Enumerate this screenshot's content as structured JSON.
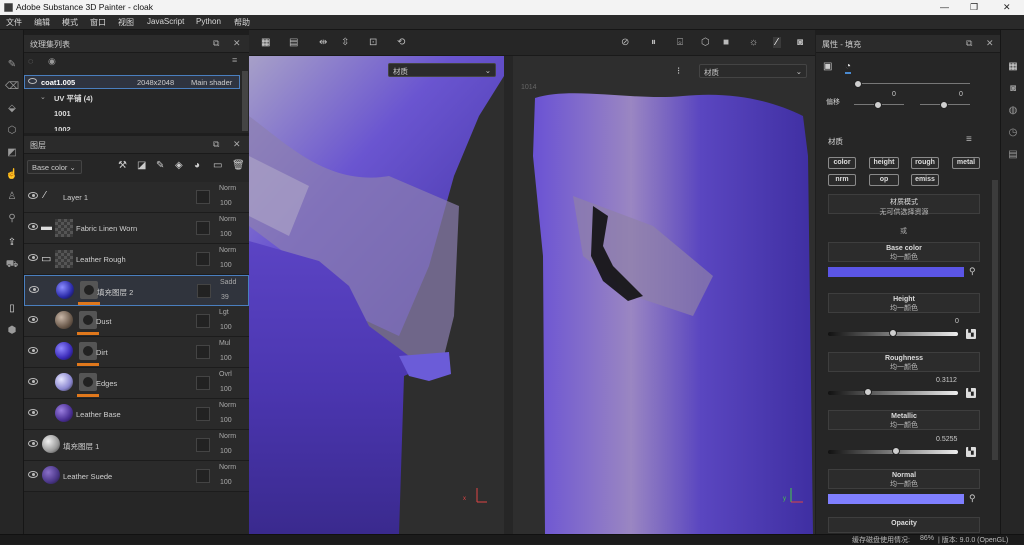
{
  "window": {
    "title": "Adobe Substance 3D Painter - cloak",
    "minimize": "—",
    "maximize": "❐",
    "close": "✕"
  },
  "menu": [
    "文件",
    "编辑",
    "模式",
    "窗口",
    "视图",
    "JavaScript",
    "Python",
    "帮助"
  ],
  "texture_set": {
    "title": "纹理集列表",
    "name": "coat1.005",
    "resolution": "2048x2048",
    "shader": "Main shader",
    "uv_label": "UV 平铺 (4)",
    "tiles": [
      "1001",
      "1002"
    ]
  },
  "layers_panel": {
    "title": "图层",
    "channel": "Base color",
    "layers": [
      {
        "name": "Layer 1",
        "blend": "Norm",
        "opacity": "100",
        "kind": "paint"
      },
      {
        "name": "Fabric Linen Worn",
        "blend": "Norm",
        "opacity": "100",
        "kind": "folder"
      },
      {
        "name": "Leather Rough",
        "blend": "Norm",
        "opacity": "100",
        "kind": "folder"
      },
      {
        "name": "填充图层 2",
        "blend": "Sadd",
        "opacity": "39",
        "kind": "fill-mask",
        "selected": true
      },
      {
        "name": "Dust",
        "blend": "Lgt",
        "opacity": "100",
        "kind": "fill-mask"
      },
      {
        "name": "Dirt",
        "blend": "Mul",
        "opacity": "100",
        "kind": "fill-mask"
      },
      {
        "name": "Edges",
        "blend": "Ovrl",
        "opacity": "100",
        "kind": "fill-mask"
      },
      {
        "name": "Leather Base",
        "blend": "Norm",
        "opacity": "100",
        "kind": "fill"
      },
      {
        "name": "填充图层 1",
        "blend": "Norm",
        "opacity": "100",
        "kind": "fill"
      },
      {
        "name": "Leather Suede",
        "blend": "Norm",
        "opacity": "100",
        "kind": "fill"
      }
    ]
  },
  "viewport": {
    "left_mode": "材质",
    "right_mode": "材质",
    "uv_tile_label": "1014"
  },
  "properties": {
    "title": "属性 - 填充",
    "offset_label": "偏移",
    "offset_values": [
      "0",
      "0"
    ],
    "material_section": "材质",
    "chips": [
      "color",
      "height",
      "rough",
      "metal",
      "nrm",
      "op",
      "emiss"
    ],
    "material_mode_title": "材质模式",
    "material_mode_value": "无可供选择资源",
    "or_label": "或",
    "channels": [
      {
        "name": "Base color",
        "sub": "均一颜色",
        "type": "color",
        "color": "#5b55e6"
      },
      {
        "name": "Height",
        "sub": "均一颜色",
        "type": "slider",
        "value": "0",
        "fraction": 0.5
      },
      {
        "name": "Roughness",
        "sub": "均一颜色",
        "type": "slider",
        "value": "0.3112",
        "fraction": 0.3112
      },
      {
        "name": "Metallic",
        "sub": "均一颜色",
        "type": "slider",
        "value": "0.5255",
        "fraction": 0.5255
      },
      {
        "name": "Normal",
        "sub": "均一颜色",
        "type": "color",
        "color": "#7f7fff"
      },
      {
        "name": "Opacity",
        "sub": "",
        "type": "none"
      }
    ]
  },
  "status": {
    "cache": "缓存磁盘使用情况:",
    "cache_value": "86%",
    "version": "| 版本: 9.0.0 (OpenGL)"
  }
}
